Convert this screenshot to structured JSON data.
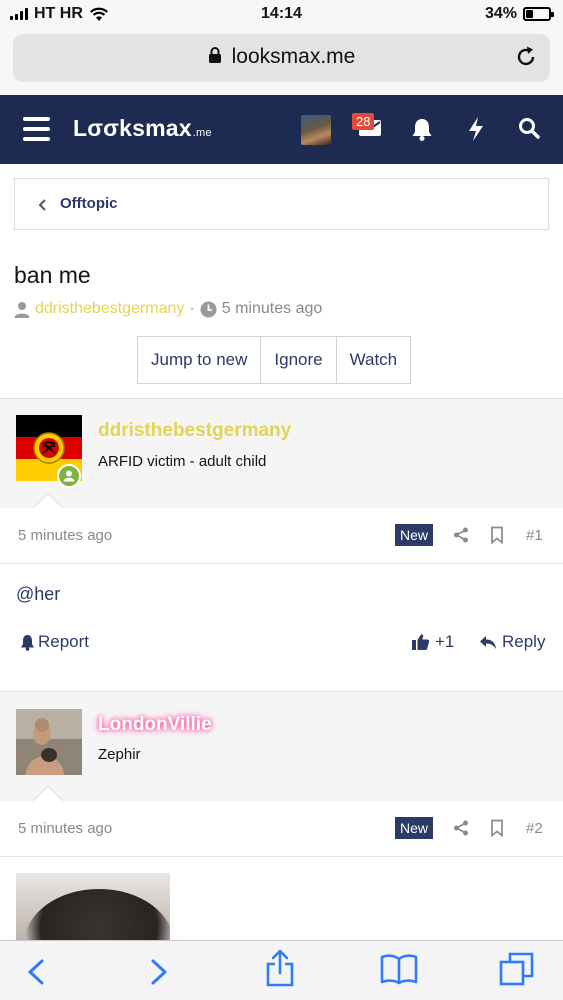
{
  "status_bar": {
    "carrier": "HT HR",
    "time": "14:14",
    "battery": "34%",
    "battery_level": 0.34
  },
  "browser": {
    "url": "looksmax.me"
  },
  "site_nav": {
    "logo_main": "Lσσksmax",
    "logo_suffix": ".me",
    "inbox_count": "28",
    "icons": [
      "menu-icon",
      "avatar",
      "mail-icon",
      "bell-icon",
      "bolt-icon",
      "search-icon"
    ],
    "accent_color": "#1d2a52"
  },
  "breadcrumb": {
    "label": "Offtopic"
  },
  "thread": {
    "title": "ban me",
    "author": "ddristhebestgermany",
    "separator": "·",
    "time": "5 minutes ago",
    "buttons": [
      "Jump to new",
      "Ignore",
      "Watch"
    ]
  },
  "posts": [
    {
      "username": "ddristhebestgermany",
      "user_title": "ARFID victim - adult child",
      "time": "5 minutes ago",
      "badge": "New",
      "number": "#1",
      "body": "@her",
      "report": "Report",
      "reactions": "+1",
      "reply": "Reply"
    },
    {
      "username": "LondonVillie",
      "user_title": "Zephir",
      "time": "5 minutes ago",
      "badge": "New",
      "number": "#2"
    }
  ],
  "toolbar": {
    "icons": [
      "back-icon",
      "forward-icon",
      "share-icon",
      "bookmarks-icon",
      "tabs-icon"
    ]
  }
}
